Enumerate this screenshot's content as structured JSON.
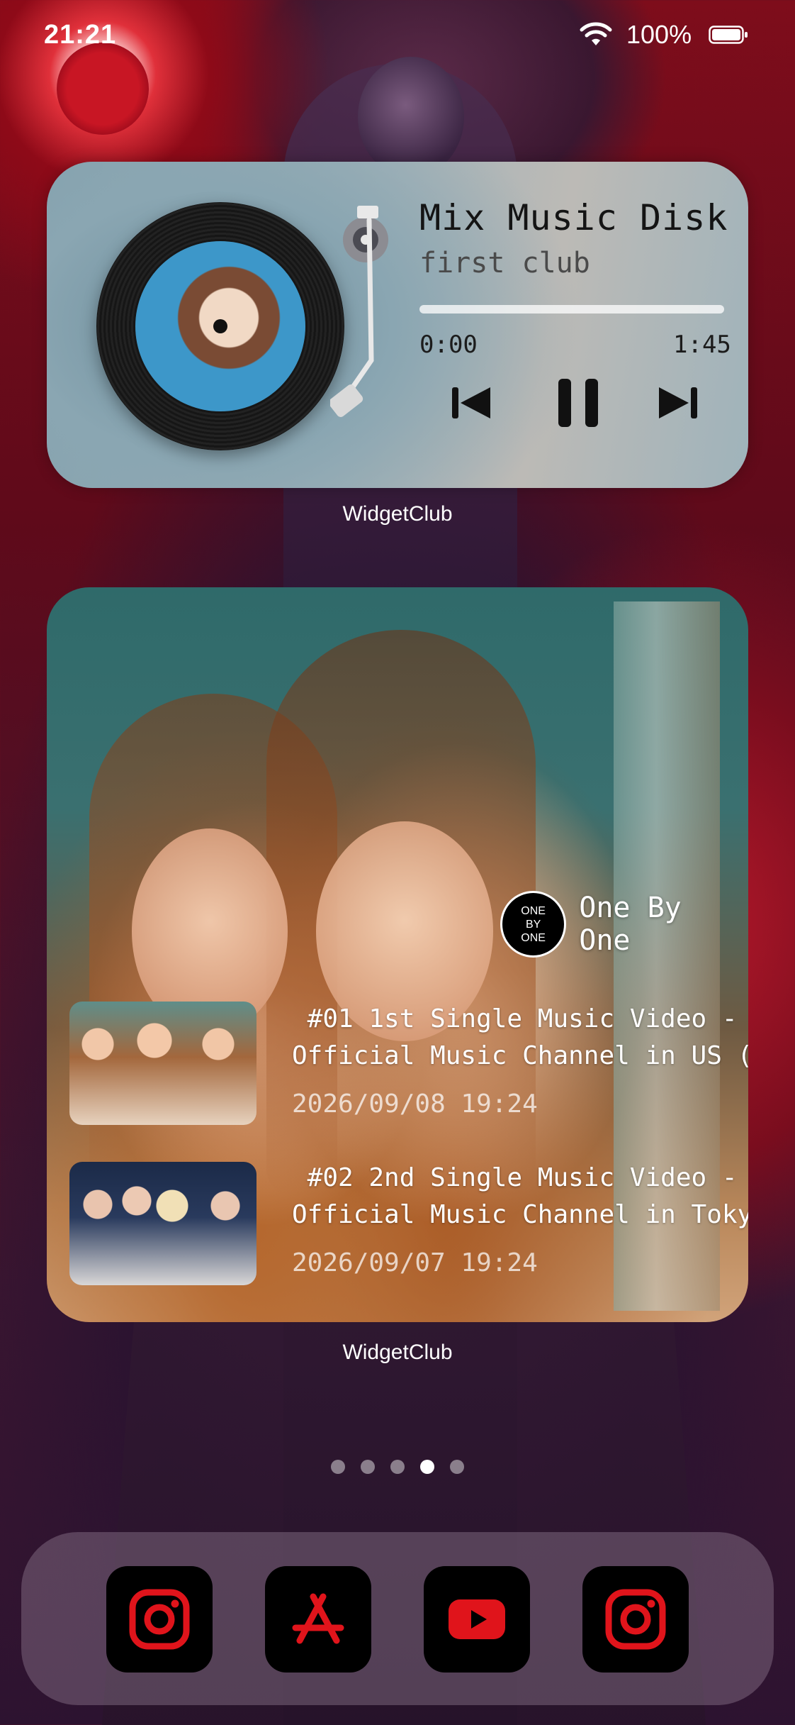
{
  "status_bar": {
    "time": "21:21",
    "battery_percent": "100%"
  },
  "music_widget": {
    "title": "Mix Music Disk",
    "artist": "first club",
    "elapsed": "0:00",
    "total": "1:45",
    "progress": 0,
    "caption": "WidgetClub"
  },
  "video_widget": {
    "channel_logo": [
      "ONE",
      "BY",
      "ONE"
    ],
    "channel_name": "One By One",
    "items": [
      {
        "title_line1": " #01 1st Single Music Video -",
        "title_line2": "Official Music Channel in US (Liv…",
        "date": "2026/09/08 19:24"
      },
      {
        "title_line1": " #02 2nd Single Music Video -",
        "title_line2": "Official Music Channel in Tokyo (…",
        "date": "2026/09/07 19:24"
      }
    ],
    "caption": "WidgetClub"
  },
  "page_dots": {
    "count": 5,
    "active_index": 3
  },
  "dock": {
    "apps": [
      {
        "icon": "instagram-icon"
      },
      {
        "icon": "app-store-icon"
      },
      {
        "icon": "youtube-icon"
      },
      {
        "icon": "instagram-icon"
      }
    ]
  },
  "colors": {
    "accent": "#e0141b",
    "dock_icon_bg": "#000000"
  }
}
